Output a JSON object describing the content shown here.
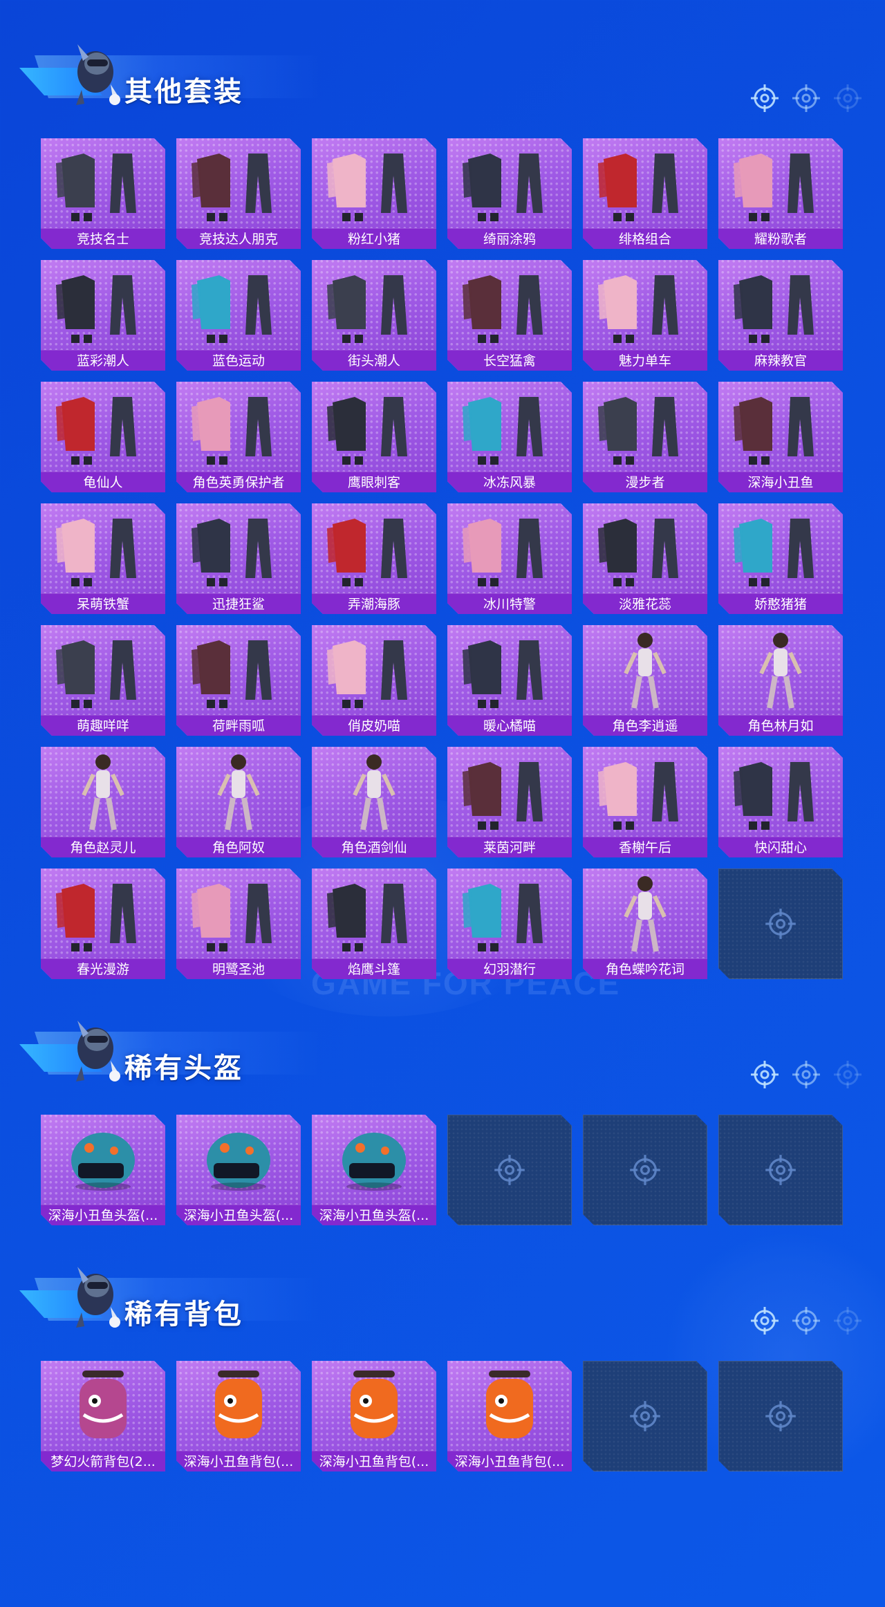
{
  "sections": [
    {
      "title": "其他套装",
      "items": [
        {
          "label": "竞技名士",
          "icon": "outfit-icon"
        },
        {
          "label": "竞技达人朋克",
          "icon": "outfit-icon"
        },
        {
          "label": "粉红小猪",
          "icon": "outfit-icon"
        },
        {
          "label": "绮丽涂鸦",
          "icon": "outfit-icon"
        },
        {
          "label": "绯格组合",
          "icon": "outfit-icon"
        },
        {
          "label": "耀粉歌者",
          "icon": "outfit-icon"
        },
        {
          "label": "蓝彩潮人",
          "icon": "outfit-icon"
        },
        {
          "label": "蓝色运动",
          "icon": "outfit-icon"
        },
        {
          "label": "街头潮人",
          "icon": "outfit-icon"
        },
        {
          "label": "长空猛禽",
          "icon": "outfit-icon"
        },
        {
          "label": "魅力单车",
          "icon": "outfit-icon"
        },
        {
          "label": "麻辣教官",
          "icon": "outfit-icon"
        },
        {
          "label": "龟仙人",
          "icon": "outfit-icon"
        },
        {
          "label": "角色英勇保护者",
          "icon": "outfit-icon"
        },
        {
          "label": "鹰眼刺客",
          "icon": "outfit-icon"
        },
        {
          "label": "冰冻风暴",
          "icon": "outfit-icon"
        },
        {
          "label": "漫步者",
          "icon": "outfit-icon"
        },
        {
          "label": "深海小丑鱼",
          "icon": "outfit-icon"
        },
        {
          "label": "呆萌铁蟹",
          "icon": "outfit-icon"
        },
        {
          "label": "迅捷狂鲨",
          "icon": "outfit-icon"
        },
        {
          "label": "弄潮海豚",
          "icon": "outfit-icon"
        },
        {
          "label": "冰川特警",
          "icon": "outfit-icon"
        },
        {
          "label": "淡雅花蕊",
          "icon": "outfit-icon"
        },
        {
          "label": "娇憨猪猪",
          "icon": "outfit-icon"
        },
        {
          "label": "萌趣咩咩",
          "icon": "outfit-icon"
        },
        {
          "label": "荷畔雨呱",
          "icon": "outfit-icon"
        },
        {
          "label": "俏皮奶喵",
          "icon": "outfit-icon"
        },
        {
          "label": "暖心橘喵",
          "icon": "outfit-icon"
        },
        {
          "label": "角色李逍遥",
          "icon": "character-icon"
        },
        {
          "label": "角色林月如",
          "icon": "character-icon"
        },
        {
          "label": "角色赵灵儿",
          "icon": "character-icon"
        },
        {
          "label": "角色阿奴",
          "icon": "character-icon"
        },
        {
          "label": "角色酒剑仙",
          "icon": "character-icon"
        },
        {
          "label": "莱茵河畔",
          "icon": "outfit-icon"
        },
        {
          "label": "香榭午后",
          "icon": "outfit-icon"
        },
        {
          "label": "快闪甜心",
          "icon": "outfit-icon"
        },
        {
          "label": "春光漫游",
          "icon": "outfit-icon"
        },
        {
          "label": "明鹭圣池",
          "icon": "outfit-icon"
        },
        {
          "label": "焰鹰斗篷",
          "icon": "outfit-icon"
        },
        {
          "label": "幻羽潜行",
          "icon": "outfit-icon"
        },
        {
          "label": "角色蝶吟花词",
          "icon": "character-icon"
        }
      ],
      "empty_slots": 1
    },
    {
      "title": "稀有头盔",
      "items": [
        {
          "label": "深海小丑鱼头盔(...",
          "icon": "helmet-icon"
        },
        {
          "label": "深海小丑鱼头盔(...",
          "icon": "helmet-icon"
        },
        {
          "label": "深海小丑鱼头盔(...",
          "icon": "helmet-icon"
        }
      ],
      "empty_slots": 3
    },
    {
      "title": "稀有背包",
      "items": [
        {
          "label": "梦幻火箭背包(2...",
          "icon": "backpack-icon"
        },
        {
          "label": "深海小丑鱼背包(...",
          "icon": "backpack-icon"
        },
        {
          "label": "深海小丑鱼背包(...",
          "icon": "backpack-icon"
        },
        {
          "label": "深海小丑鱼背包(...",
          "icon": "backpack-icon"
        }
      ],
      "empty_slots": 2
    }
  ],
  "watermark": "GAME FOR PEACE",
  "colors": {
    "background": "#0b4fe0",
    "card": "#a05be6",
    "card_label": "#8329cf",
    "empty_card": "#1e3f78"
  }
}
